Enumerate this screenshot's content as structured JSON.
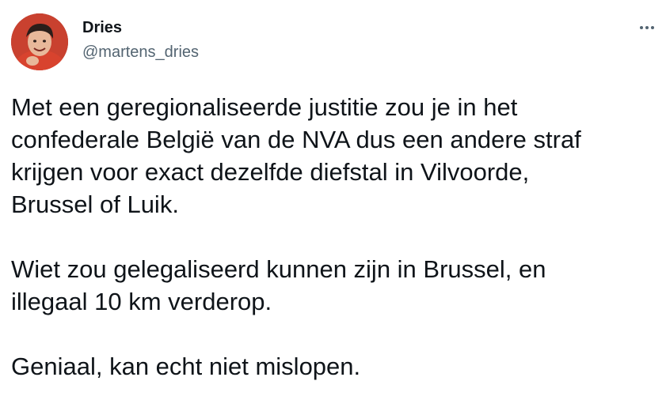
{
  "author": {
    "name": "Dries",
    "handle": "@martens_dries",
    "avatar_icon": "profile-photo"
  },
  "more_icon": "more-options-icon",
  "tweet": {
    "paragraphs": [
      "Met een geregionaliseerde justitie zou je in het\nconfederale België van de NVA dus een andere straf\nkrijgen voor exact dezelfde diefstal in Vilvoorde,\nBrussel of Luik.",
      "Wiet zou gelegaliseerd kunnen zijn in Brussel, en\nillegaal 10 km verderop.",
      "Geniaal, kan echt niet mislopen."
    ]
  },
  "colors": {
    "text": "#0f1419",
    "secondary": "#536471",
    "background": "#ffffff"
  }
}
